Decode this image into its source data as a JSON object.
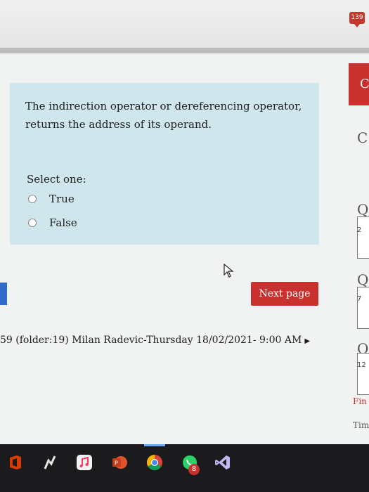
{
  "browser": {
    "badge_count": "139"
  },
  "question": {
    "text": "The indirection operator or dereferencing operator, returns the address of its operand.",
    "select_label": "Select one:",
    "options": [
      {
        "label": "True",
        "selected": false
      },
      {
        "label": "False",
        "selected": false
      }
    ]
  },
  "navigation": {
    "next_label": "Next page",
    "jump_link_label": "59 (folder:19) Milan Radevic-Thursday 18/02/2021- 9:00 AM"
  },
  "quiz_nav": {
    "items": [
      "C",
      "C",
      "Q",
      "Q",
      "Q"
    ],
    "numbers": [
      "2",
      "7",
      "12"
    ],
    "finish_label": "Fin",
    "time_label": "Tim"
  },
  "taskbar": {
    "badge_count": "8"
  },
  "colors": {
    "accent_red": "#c9312f",
    "panel": "#cfe7ec",
    "taskbar": "#1b1b1d"
  }
}
